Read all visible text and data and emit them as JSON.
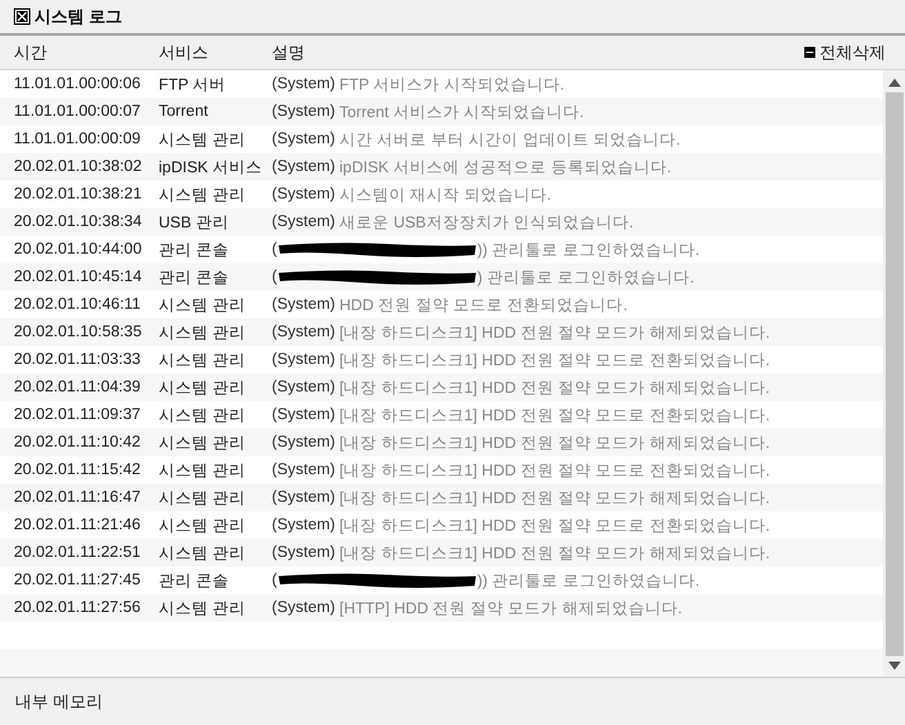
{
  "window": {
    "title": "시스템 로그"
  },
  "table": {
    "columns": [
      "시간",
      "서비스",
      "설명"
    ],
    "action": "전체삭제",
    "rows": [
      {
        "time": "11.01.01.00:00:06",
        "service": "FTP 서버",
        "kind": "system",
        "source": "(System)",
        "message": "FTP 서비스가 시작되었습니다."
      },
      {
        "time": "11.01.01.00:00:07",
        "service": "Torrent",
        "kind": "system",
        "source": "(System)",
        "message": "Torrent 서비스가 시작되었습니다."
      },
      {
        "time": "11.01.01.00:00:09",
        "service": "시스템 관리",
        "kind": "system",
        "source": "(System)",
        "message": "시간 서버로 부터 시간이 업데이트 되었습니다."
      },
      {
        "time": "20.02.01.10:38:02",
        "service": "ipDISK 서비스",
        "kind": "system",
        "source": "(System)",
        "message": "ipDISK 서비스에 성공적으로 등록되었습니다."
      },
      {
        "time": "20.02.01.10:38:21",
        "service": "시스템 관리",
        "kind": "system",
        "source": "(System)",
        "message": "시스템이 재시작 되었습니다."
      },
      {
        "time": "20.02.01.10:38:34",
        "service": "USB 관리",
        "kind": "system",
        "source": "(System)",
        "message": "새로운 USB저장장치가 인식되었습니다."
      },
      {
        "time": "20.02.01.10:44:00",
        "service": "관리 콘솔",
        "kind": "redacted",
        "source": "(",
        "message": ")) 관리툴로 로그인하였습니다."
      },
      {
        "time": "20.02.01.10:45:14",
        "service": "관리 콘솔",
        "kind": "redacted",
        "source": "(",
        "message": ") 관리툴로 로그인하였습니다."
      },
      {
        "time": "20.02.01.10:46:11",
        "service": "시스템 관리",
        "kind": "system",
        "source": "(System)",
        "message": "HDD 전원 절약 모드로 전환되었습니다."
      },
      {
        "time": "20.02.01.10:58:35",
        "service": "시스템 관리",
        "kind": "system",
        "source": "(System)",
        "message": "[내장 하드디스크1] HDD 전원 절약 모드가 해제되었습니다."
      },
      {
        "time": "20.02.01.11:03:33",
        "service": "시스템 관리",
        "kind": "system",
        "source": "(System)",
        "message": "[내장 하드디스크1] HDD 전원 절약 모드로 전환되었습니다."
      },
      {
        "time": "20.02.01.11:04:39",
        "service": "시스템 관리",
        "kind": "system",
        "source": "(System)",
        "message": "[내장 하드디스크1] HDD 전원 절약 모드가 해제되었습니다."
      },
      {
        "time": "20.02.01.11:09:37",
        "service": "시스템 관리",
        "kind": "system",
        "source": "(System)",
        "message": "[내장 하드디스크1] HDD 전원 절약 모드로 전환되었습니다."
      },
      {
        "time": "20.02.01.11:10:42",
        "service": "시스템 관리",
        "kind": "system",
        "source": "(System)",
        "message": "[내장 하드디스크1] HDD 전원 절약 모드가 해제되었습니다."
      },
      {
        "time": "20.02.01.11:15:42",
        "service": "시스템 관리",
        "kind": "system",
        "source": "(System)",
        "message": "[내장 하드디스크1] HDD 전원 절약 모드로 전환되었습니다."
      },
      {
        "time": "20.02.01.11:16:47",
        "service": "시스템 관리",
        "kind": "system",
        "source": "(System)",
        "message": "[내장 하드디스크1] HDD 전원 절약 모드가 해제되었습니다."
      },
      {
        "time": "20.02.01.11:21:46",
        "service": "시스템 관리",
        "kind": "system",
        "source": "(System)",
        "message": "[내장 하드디스크1] HDD 전원 절약 모드로 전환되었습니다."
      },
      {
        "time": "20.02.01.11:22:51",
        "service": "시스템 관리",
        "kind": "system",
        "source": "(System)",
        "message": "[내장 하드디스크1] HDD 전원 절약 모드가 해제되었습니다."
      },
      {
        "time": "20.02.01.11:27:45",
        "service": "관리 콘솔",
        "kind": "redacted",
        "source": "(",
        "message": ")) 관리툴로 로그인하였습니다."
      },
      {
        "time": "20.02.01.11:27:56",
        "service": "시스템 관리",
        "kind": "system",
        "source": "(System)",
        "message": "[HTTP] HDD 전원 절약 모드가 해제되었습니다."
      }
    ]
  },
  "footer": {
    "label": "내부 메모리"
  }
}
